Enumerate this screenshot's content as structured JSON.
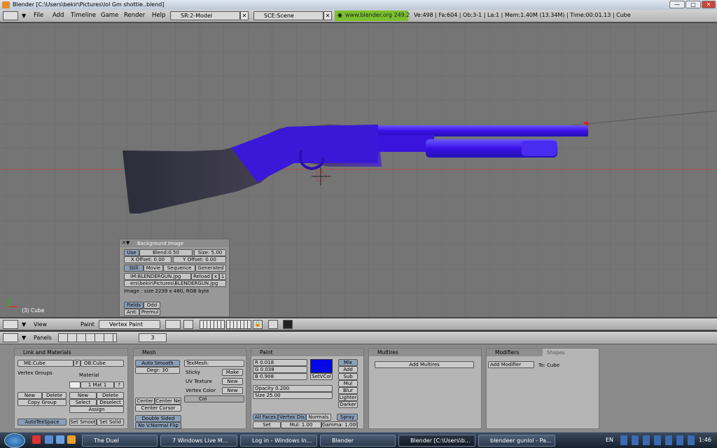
{
  "window": {
    "title": "Blender [C:\\Users\\bekir\\Pictures\\lol Gm shottie..blend]",
    "min": "—",
    "max": "□",
    "close": "✕"
  },
  "menubar": {
    "items": [
      "File",
      "Add",
      "Timeline",
      "Game",
      "Render",
      "Help"
    ],
    "screen": "SR:2-Model",
    "scene": "SCE:Scene",
    "website": "www.blender.org 249.2",
    "info": "Ve:498 | Fa:604 | Ob:3-1 | La:1  | Mem:1.40M (13.34M) | Time:00:01.13 | Cube"
  },
  "viewport": {
    "object_label": "(3) Cube"
  },
  "bgimage": {
    "title": "Background Image",
    "use": "Use",
    "blend": "Blend:0.50",
    "size": "Size: 5.00",
    "xoff": "X Offset: 0.00",
    "yoff": "Y Offset: 0.00",
    "tabs": [
      "Still",
      "Movie",
      "Sequence",
      "Generated"
    ],
    "im": "IM:BLENDERGUN.jpg",
    "reload": "Reload",
    "x": "x",
    "one": "1",
    "path": "ers\\bekir\\Pictures\\BLENDERGUN.jpg",
    "info": "Image : size 2239 x 480, RGB byte",
    "fields": "Fields",
    "odd": "Odd",
    "anti": "Anti",
    "premul": "Premul"
  },
  "header3d": {
    "view": "View",
    "paint": "Paint",
    "mode": "Vertex Paint"
  },
  "buttonsheader": {
    "panels": "Panels",
    "frame": "3"
  },
  "panels": {
    "link": {
      "title": "Link and Materials",
      "me": "ME:Cube",
      "f": "F",
      "ob": "OB:Cube",
      "vgroups": "Vertex Groups",
      "material": "Material",
      "mat": "1 Mat 1",
      "q": "?",
      "new": "New",
      "delete": "Delete",
      "copygroup": "Copy Group",
      "new2": "New",
      "delete2": "Delete",
      "select": "Select",
      "deselect": "Deselect",
      "assign": "Assign",
      "autotex": "AutoTexSpace",
      "setsmooth": "Set Smoot",
      "setsolid": "Set Solid"
    },
    "mesh": {
      "title": "Mesh",
      "autosmooth": "Auto Smooth",
      "degr": "Degr: 30",
      "texmesh": "TexMesh:",
      "sticky": "Sticky",
      "make": "Make",
      "uvtex": "UV Texture",
      "new": "New",
      "vcol": "Vertex Color",
      "new2": "New",
      "col": "Col",
      "center": "Center",
      "centernew": "Center Ne",
      "centercursor": "Center Cursor",
      "doublesided": "Double Sided",
      "novnormal": "No V.Normal Flip"
    },
    "paint": {
      "title": "Paint",
      "r": "R 0.018",
      "g": "G 0.038",
      "b": "B 0.908",
      "setvcol": "SetVCol",
      "modes": [
        "Mix",
        "Add",
        "Sub",
        "Mul",
        "Blur",
        "Lighter",
        "Darker"
      ],
      "opacity": "Opacity 0.200",
      "size": "Size 25.00",
      "allfaces": "All Faces",
      "vertexdist": "Vertex Dis",
      "normals": "Normals",
      "spray": "Spray",
      "set": "Set",
      "mul": "Mul: 1.00",
      "gamma": "Gamma: 1.000"
    },
    "multires": {
      "title": "Multires",
      "add": "Add Multires"
    },
    "modifiers": {
      "title": "Modifiers",
      "shapes": "Shapes",
      "add": "Add Modifier",
      "to": "To: Cube"
    }
  },
  "taskbar": {
    "tasks": [
      "The Duel",
      "7 Windows Live M...",
      "Log in - Windows In...",
      "Blender",
      "Blender [C:\\Users\\b...",
      "blendeer gunlol - Pa..."
    ],
    "lang": "EN",
    "clock": "1:46"
  },
  "colors": {
    "gun_blue": "#3a10e6",
    "paint_swatch": "#0407e8"
  }
}
